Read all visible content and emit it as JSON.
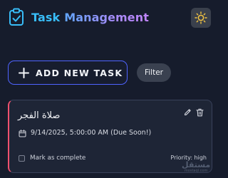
{
  "header": {
    "title_part1": "Task",
    "title_part2": "Management",
    "logo_icon": "clipboard-check-icon",
    "theme_toggle_icon": "sun-icon"
  },
  "actions": {
    "add_label": "ADD NEW TASK",
    "add_icon": "plus-icon",
    "filter_label": "Filter"
  },
  "task": {
    "title": "صلاة الفجر",
    "due": "9/14/2025, 5:00:00 AM (Due Soon!)",
    "complete_label": "Mark as complete",
    "completed": false,
    "priority": "Priority: high",
    "priority_color": "#f0506e"
  },
  "watermark": {
    "main": "مستقل",
    "sub": "mostaql.com"
  },
  "colors": {
    "background": "#161c2c",
    "card": "#1e2536",
    "accent_blue": "#4f63ff",
    "title_cyan": "#38bdf8",
    "title_gradient_end": "#c084fc"
  }
}
